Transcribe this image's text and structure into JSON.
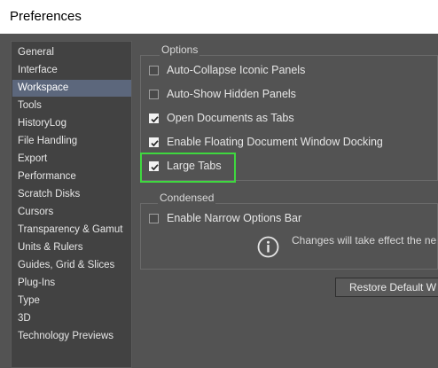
{
  "window": {
    "title": "Preferences"
  },
  "sidebar": {
    "items": [
      {
        "label": "General",
        "selected": false
      },
      {
        "label": "Interface",
        "selected": false
      },
      {
        "label": "Workspace",
        "selected": true
      },
      {
        "label": "Tools",
        "selected": false
      },
      {
        "label": "HistoryLog",
        "selected": false
      },
      {
        "label": "File Handling",
        "selected": false
      },
      {
        "label": "Export",
        "selected": false
      },
      {
        "label": "Performance",
        "selected": false
      },
      {
        "label": "Scratch Disks",
        "selected": false
      },
      {
        "label": "Cursors",
        "selected": false
      },
      {
        "label": "Transparency & Gamut",
        "selected": false
      },
      {
        "label": "Units & Rulers",
        "selected": false
      },
      {
        "label": "Guides, Grid & Slices",
        "selected": false
      },
      {
        "label": "Plug-Ins",
        "selected": false
      },
      {
        "label": "Type",
        "selected": false
      },
      {
        "label": "3D",
        "selected": false
      },
      {
        "label": "Technology Previews",
        "selected": false
      }
    ]
  },
  "options_group": {
    "label": "Options",
    "items": [
      {
        "label": "Auto-Collapse Iconic Panels",
        "checked": false
      },
      {
        "label": "Auto-Show Hidden Panels",
        "checked": false
      },
      {
        "label": "Open Documents as Tabs",
        "checked": true
      },
      {
        "label": "Enable Floating Document Window Docking",
        "checked": true
      },
      {
        "label": "Large Tabs",
        "checked": true
      }
    ]
  },
  "condensed_group": {
    "label": "Condensed",
    "items": [
      {
        "label": "Enable Narrow Options Bar",
        "checked": false
      }
    ],
    "note": "Changes will take effect the ne"
  },
  "buttons": {
    "restore_label": "Restore Default W"
  },
  "colors": {
    "background": "#535353",
    "sidebar_background": "#424242",
    "selection": "#5c677c",
    "highlight": "#3fd83f"
  }
}
